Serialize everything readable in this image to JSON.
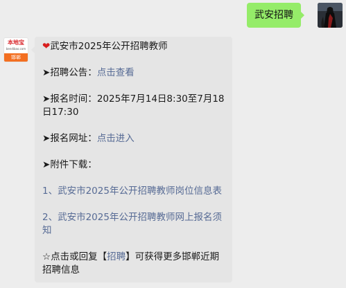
{
  "outgoing": {
    "text": "武安招聘"
  },
  "brand": {
    "name": "本地宝",
    "url": "bendibao.com",
    "city": "邯郸"
  },
  "message": {
    "heart_icon": "❤",
    "title": "武安市2025年公开招聘教师",
    "arrow_icon": "➤",
    "announcement_label": "招聘公告：",
    "announcement_link": "点击查看",
    "time_label": "报名时间：",
    "time_value": "2025年7月14日8:30至7月18日17:30",
    "site_label": "报名网址：",
    "site_link": "点击进入",
    "attachments_label": "附件下载：",
    "attachment_1": "1、武安市2025年公开招聘教师岗位信息表",
    "attachment_2": "2、武安市2025年公开招聘教师网上报名须知",
    "star_icon": "☆",
    "footer_pre": "点击或回复【",
    "footer_link": "招聘",
    "footer_post": "】可获得更多邯郸近期招聘信息"
  }
}
